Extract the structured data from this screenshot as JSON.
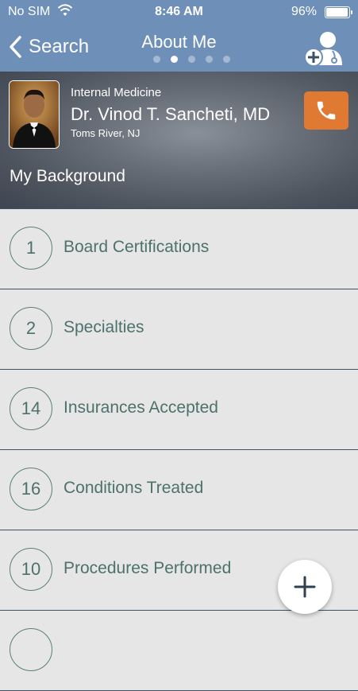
{
  "status_bar": {
    "carrier": "No SIM",
    "time": "8:46 AM",
    "battery_percent": "96%",
    "battery_level": 0.96
  },
  "nav": {
    "back_label": "Search",
    "title": "About Me",
    "page_count": 5,
    "active_page": 2
  },
  "profile": {
    "specialty": "Internal Medicine",
    "name": "Dr. Vinod T. Sancheti, MD",
    "location": "Toms River, NJ",
    "section_heading": "My Background"
  },
  "list": [
    {
      "count": "1",
      "label": "Board Certifications"
    },
    {
      "count": "2",
      "label": "Specialties"
    },
    {
      "count": "14",
      "label": "Insurances Accepted"
    },
    {
      "count": "16",
      "label": "Conditions Treated"
    },
    {
      "count": "10",
      "label": "Procedures Performed"
    },
    {
      "count": "",
      "label": ""
    }
  ],
  "icons": {
    "back": "chevron-left-icon",
    "add_doctor": "add-doctor-icon",
    "call": "phone-icon",
    "fab": "plus-icon",
    "wifi": "wifi-icon"
  },
  "colors": {
    "nav_bg": "#6e8fb8",
    "accent_call": "#e07a33",
    "list_text": "#4d716b",
    "list_bg": "#e6e6e6"
  }
}
